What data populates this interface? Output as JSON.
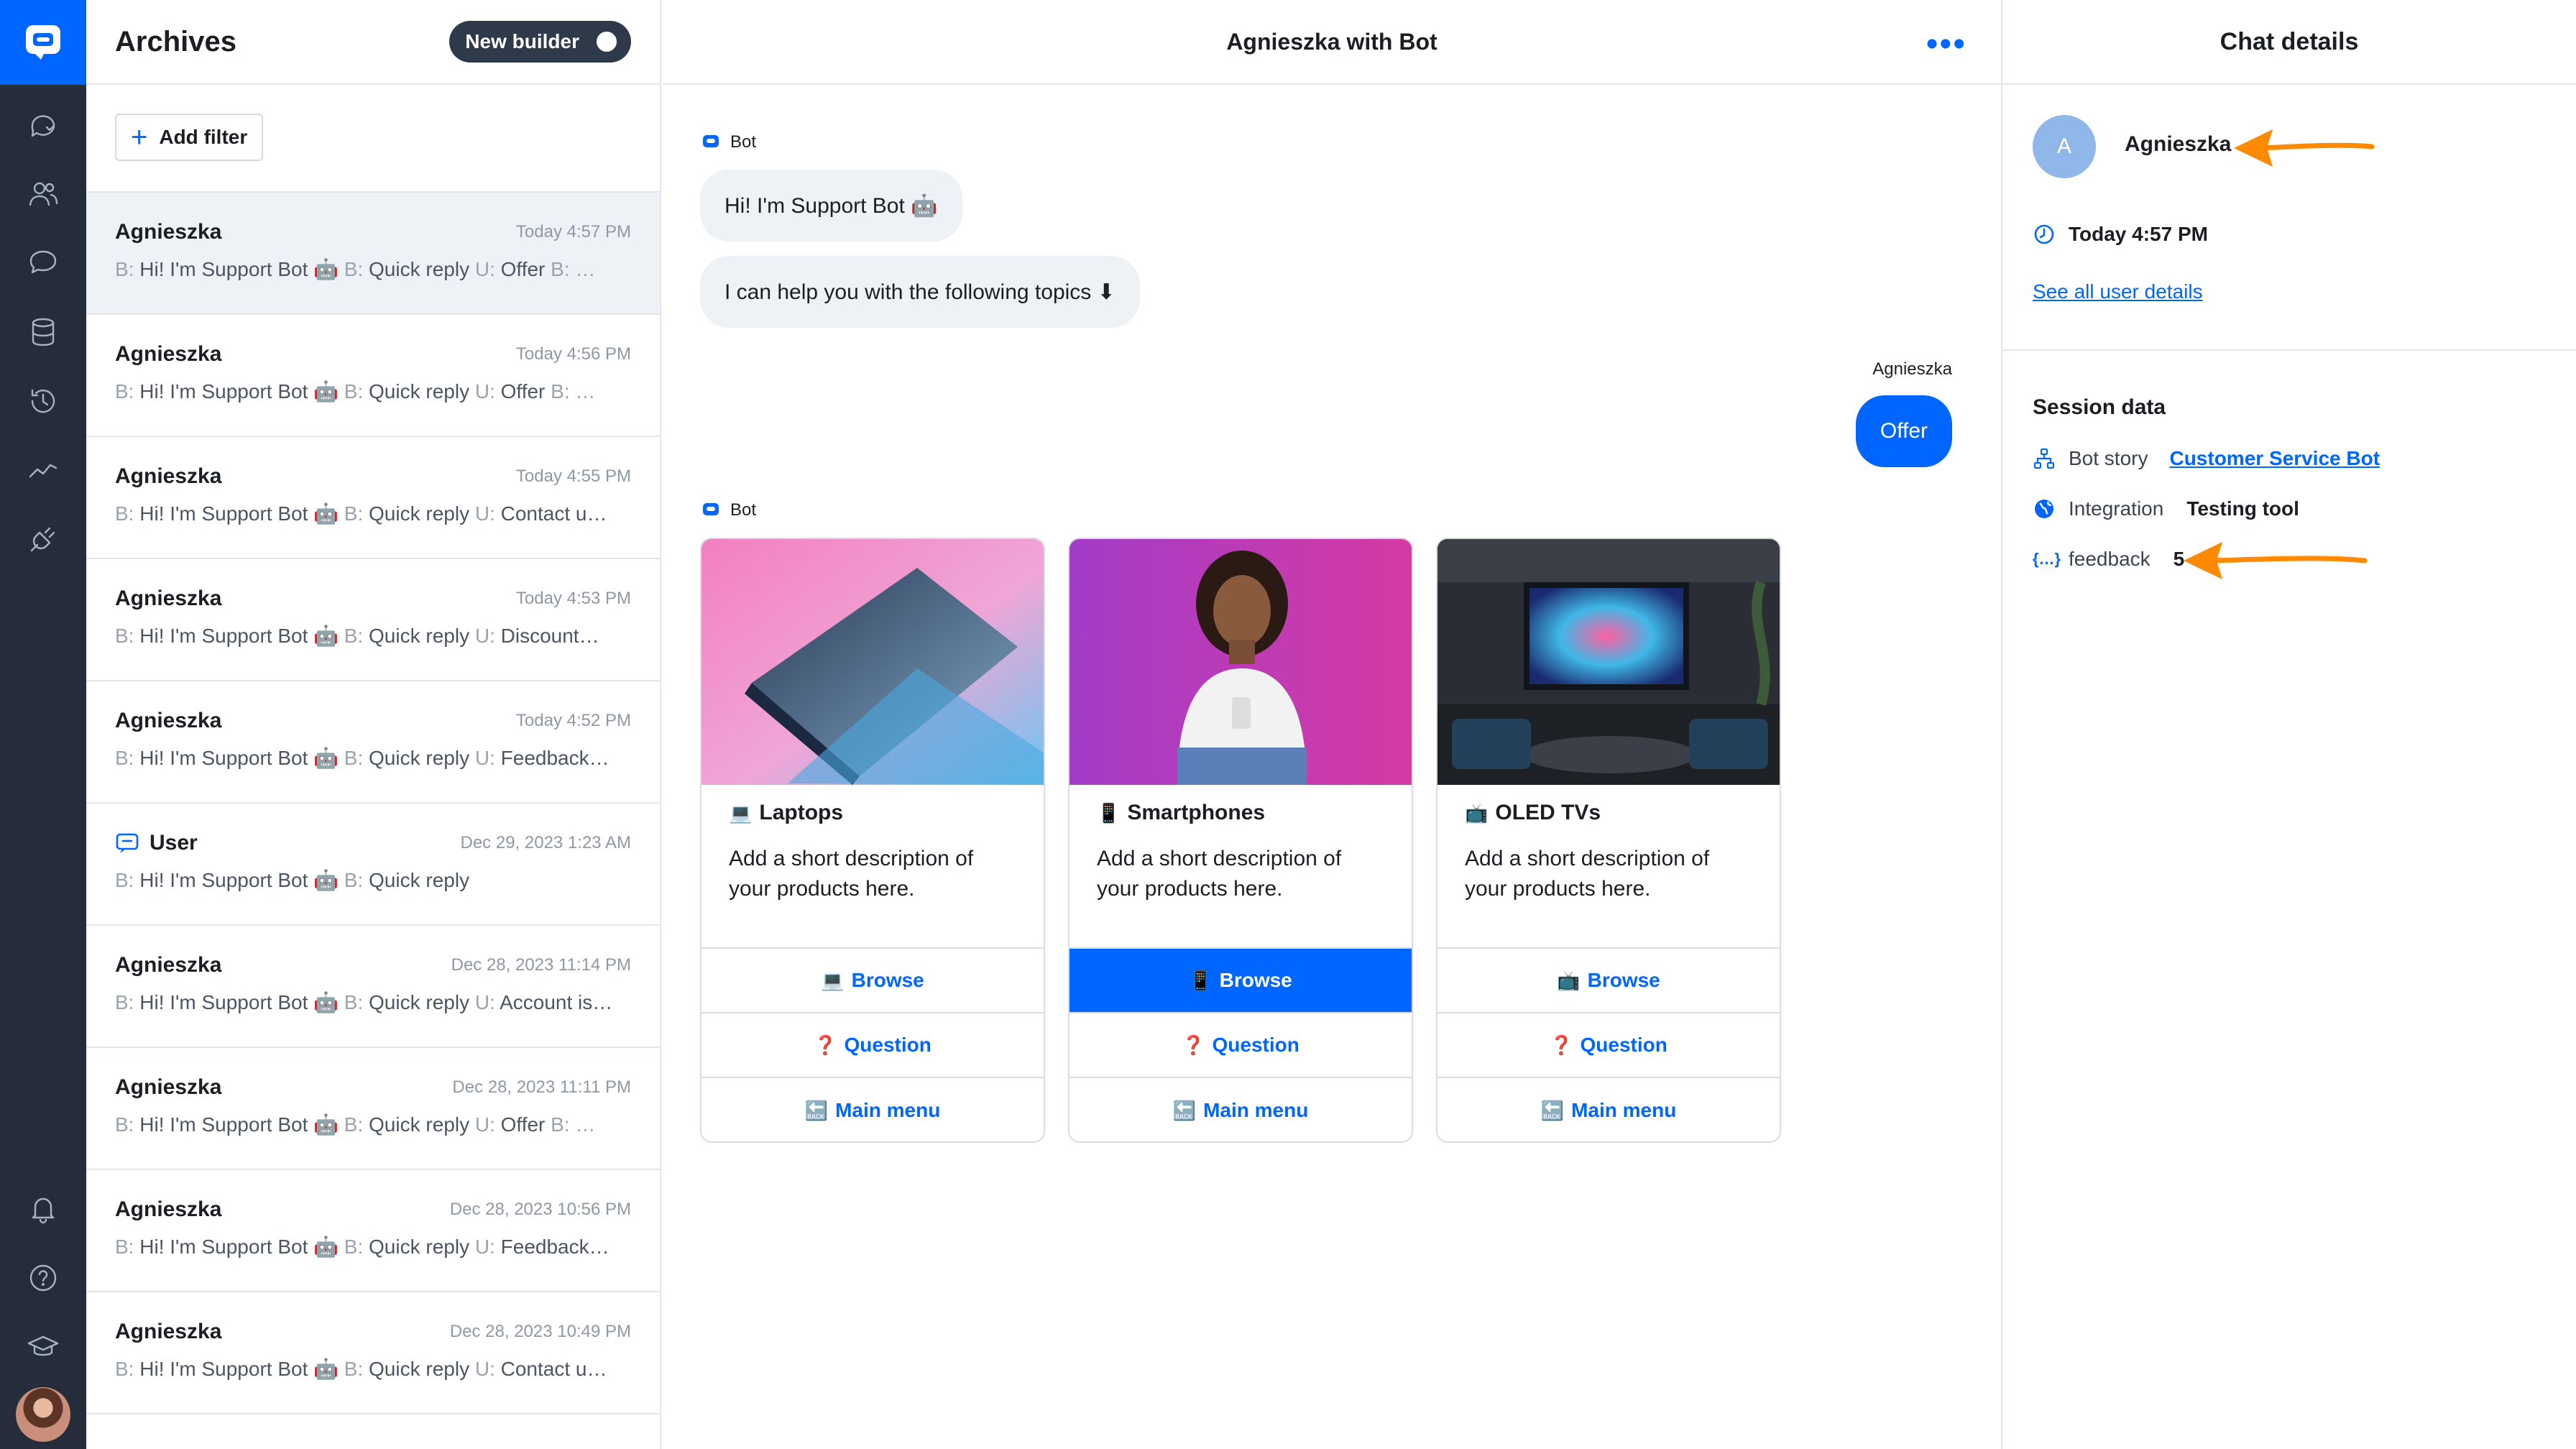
{
  "sidebar": {
    "icons": [
      "chat-bubble-icon",
      "users-icon",
      "conversations-icon",
      "database-icon",
      "history-icon",
      "analytics-icon",
      "integrations-icon",
      "bell-icon",
      "help-icon",
      "academy-icon"
    ]
  },
  "archives": {
    "title": "Archives",
    "toggle_label": "New builder",
    "add_filter_label": "Add filter",
    "conversations": [
      {
        "name": "Agnieszka",
        "time": "Today 4:57 PM",
        "preview": "Hi! I'm Support Bot 🤖",
        "last_prefix": "U:",
        "last": "Offer",
        "tail": "B: …"
      },
      {
        "name": "Agnieszka",
        "time": "Today 4:56 PM",
        "preview": "Hi! I'm Support Bot 🤖",
        "last_prefix": "U:",
        "last": "Offer",
        "tail": "B: …"
      },
      {
        "name": "Agnieszka",
        "time": "Today 4:55 PM",
        "preview": "Hi! I'm Support Bot 🤖",
        "last_prefix": "U:",
        "last": "Contact u…",
        "tail": ""
      },
      {
        "name": "Agnieszka",
        "time": "Today 4:53 PM",
        "preview": "Hi! I'm Support Bot 🤖",
        "last_prefix": "U:",
        "last": "Discount…",
        "tail": ""
      },
      {
        "name": "Agnieszka",
        "time": "Today 4:52 PM",
        "preview": "Hi! I'm Support Bot 🤖",
        "last_prefix": "U:",
        "last": "Feedback…",
        "tail": ""
      },
      {
        "name": "User",
        "time": "Dec 29, 2023 1:23 AM",
        "preview": "Hi! I'm Support Bot 🤖",
        "last_prefix": "",
        "last": "",
        "tail": ""
      },
      {
        "name": "Agnieszka",
        "time": "Dec 28, 2023 11:14 PM",
        "preview": "Hi! I'm Support Bot 🤖",
        "last_prefix": "U:",
        "last": "Account is…",
        "tail": ""
      },
      {
        "name": "Agnieszka",
        "time": "Dec 28, 2023 11:11 PM",
        "preview": "Hi! I'm Support Bot 🤖",
        "last_prefix": "U:",
        "last": "Offer",
        "tail": "B: …"
      },
      {
        "name": "Agnieszka",
        "time": "Dec 28, 2023 10:56 PM",
        "preview": "Hi! I'm Support Bot 🤖",
        "last_prefix": "U:",
        "last": "Feedback…",
        "tail": ""
      },
      {
        "name": "Agnieszka",
        "time": "Dec 28, 2023 10:49 PM",
        "preview": "Hi! I'm Support Bot 🤖",
        "last_prefix": "U:",
        "last": "Contact u…",
        "tail": ""
      }
    ],
    "bot_prefix": "B:",
    "quick_reply": "Quick reply"
  },
  "chat": {
    "title": "Agnieszka with Bot",
    "bot_label": "Bot",
    "user_label": "Agnieszka",
    "greeting": "Hi! I'm Support Bot 🤖",
    "help_text": "I can help you with the following topics ⬇",
    "user_reply": "Offer",
    "cards": [
      {
        "emoji": "💻",
        "title": "Laptops",
        "desc": "Add a short description of your products here.",
        "browse_emoji": "💻",
        "browse": "Browse",
        "question_emoji": "❓",
        "question": "Question",
        "menu_emoji": "🔙",
        "menu": "Main menu"
      },
      {
        "emoji": "📱",
        "title": "Smartphones",
        "desc": "Add a short description of your products here.",
        "browse_emoji": "📱",
        "browse": "Browse",
        "question_emoji": "❓",
        "question": "Question",
        "menu_emoji": "🔙",
        "menu": "Main menu"
      },
      {
        "emoji": "📺",
        "title": "OLED TVs",
        "desc": "Add a short description of your products here.",
        "browse_emoji": "📺",
        "browse": "Browse",
        "question_emoji": "❓",
        "question": "Question",
        "menu_emoji": "🔙",
        "menu": "Main menu"
      }
    ]
  },
  "details": {
    "title": "Chat details",
    "avatar_letter": "A",
    "name": "Agnieszka",
    "time": "Today 4:57 PM",
    "see_all": "See all user details",
    "session_title": "Session data",
    "bot_story_label": "Bot story",
    "bot_story_value": "Customer Service Bot",
    "integration_label": "Integration",
    "integration_value": "Testing tool",
    "feedback_label": "feedback",
    "feedback_value": "5"
  },
  "colors": {
    "accent": "#0066ff",
    "rail": "#252d3a",
    "arrow": "#ff8a00"
  }
}
